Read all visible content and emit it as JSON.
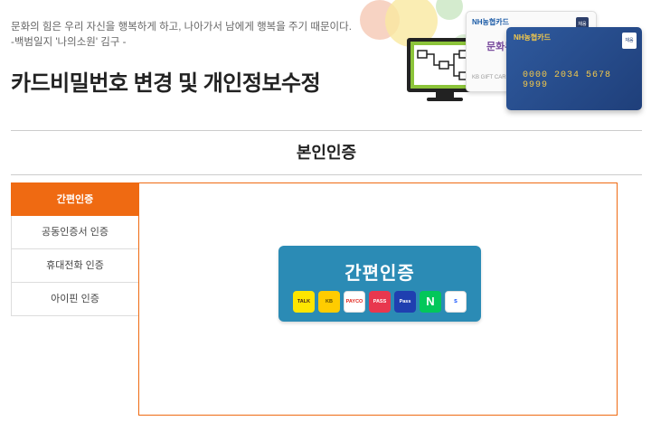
{
  "header": {
    "quote_line1": "문화의 힘은 우리 자신을 행복하게 하고, 나아가서 남에게 행복을 주기 때문이다.",
    "quote_line2": "-백범일지 '나의소원' 김구 -",
    "title": "카드비밀번호 변경 및 개인정보수정"
  },
  "banner": {
    "card_white_brand": "NH농협카드",
    "card_white_logo": "문화누리",
    "card_white_small": "KB GIFT CARD",
    "card_blue_brand": "NH농협카드",
    "card_blue_number": "0000 2034 5678 9999",
    "tag": "채움"
  },
  "section": {
    "title": "본인인증"
  },
  "sidebar": {
    "items": [
      {
        "label": "간편인증",
        "active": true
      },
      {
        "label": "공동인증서 인증",
        "active": false
      },
      {
        "label": "휴대전화 인증",
        "active": false
      },
      {
        "label": "아이핀 인증",
        "active": false
      }
    ]
  },
  "auth": {
    "button_label": "간편인증",
    "providers": [
      {
        "name": "kakao-icon",
        "text": "TALK"
      },
      {
        "name": "kb-icon",
        "text": "KB"
      },
      {
        "name": "payco-icon",
        "text": "PAYCO"
      },
      {
        "name": "pass-icon",
        "text": "PASS"
      },
      {
        "name": "samsung-pass-icon",
        "text": "Pass"
      },
      {
        "name": "naver-icon",
        "text": "N"
      },
      {
        "name": "shinhan-icon",
        "text": "S"
      }
    ]
  },
  "colors": {
    "accent": "#ef6a12",
    "auth_button": "#2b8bb5"
  }
}
